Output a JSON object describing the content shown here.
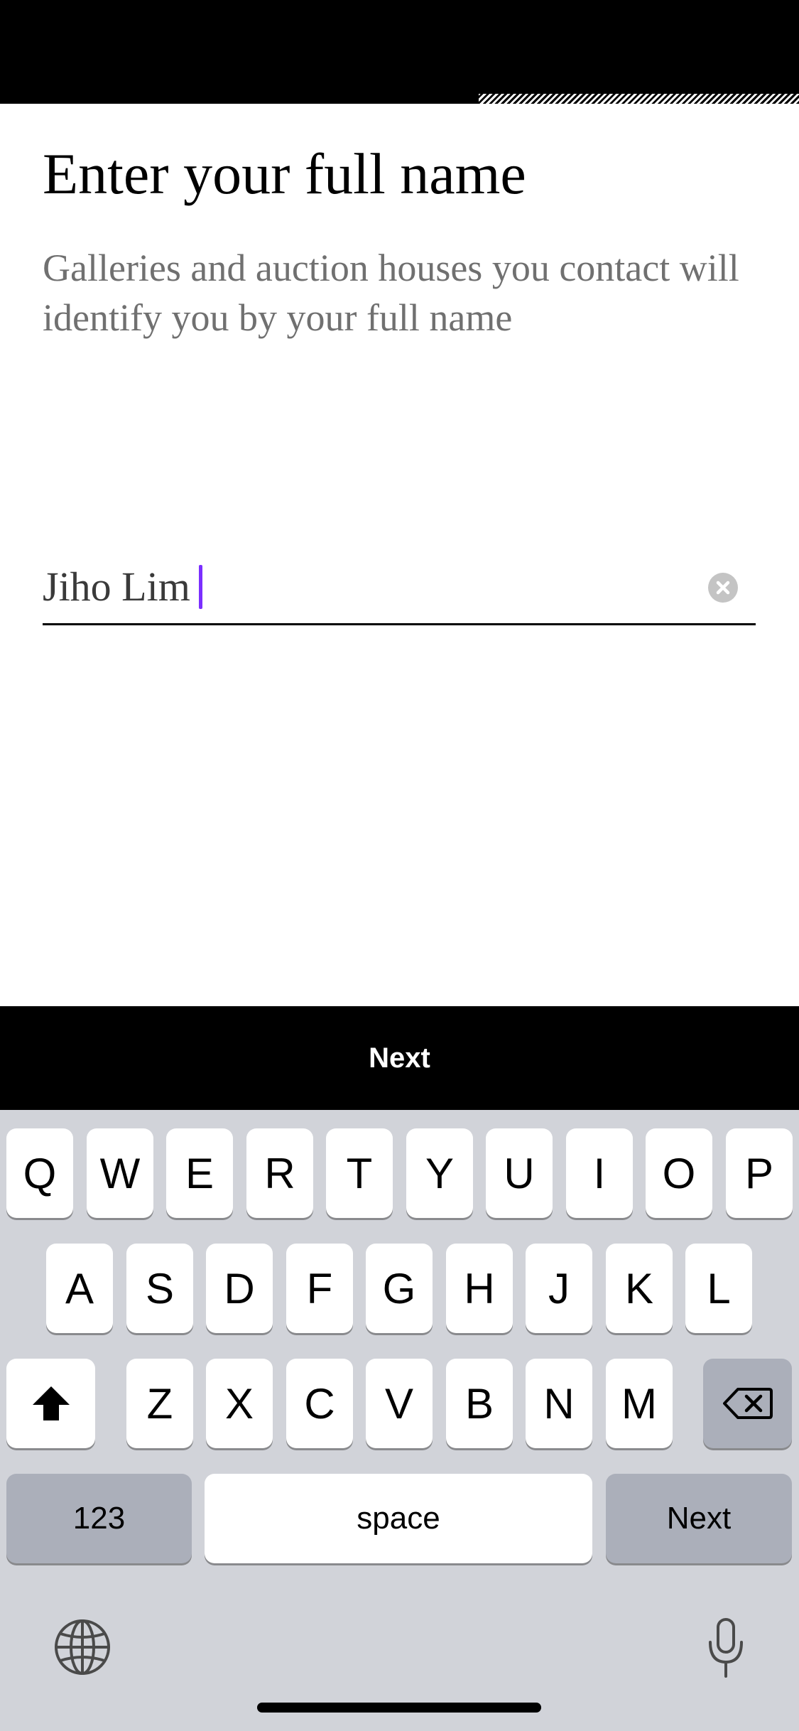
{
  "header": {
    "title": "Enter your full name",
    "subtitle": "Galleries and auction houses you contact will identify you by your full name"
  },
  "name_field": {
    "value": "Jiho Lim",
    "clear_icon": "clear-circle-icon"
  },
  "actions": {
    "next_label": "Next"
  },
  "keyboard": {
    "row1": [
      "Q",
      "W",
      "E",
      "R",
      "T",
      "Y",
      "U",
      "I",
      "O",
      "P"
    ],
    "row2": [
      "A",
      "S",
      "D",
      "F",
      "G",
      "H",
      "J",
      "K",
      "L"
    ],
    "row3": [
      "Z",
      "X",
      "C",
      "V",
      "B",
      "N",
      "M"
    ],
    "numbers_label": "123",
    "space_label": "space",
    "return_label": "Next",
    "shift_icon": "shift-icon",
    "backspace_icon": "backspace-icon",
    "globe_icon": "globe-icon",
    "mic_icon": "microphone-icon"
  },
  "colors": {
    "accent_caret": "#7b2fff",
    "primary": "#000000",
    "subtitle_text": "#707070",
    "keyboard_bg": "#d1d3d9"
  }
}
